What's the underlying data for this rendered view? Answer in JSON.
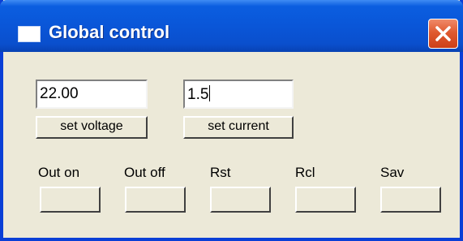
{
  "window": {
    "title": "Global control",
    "close_icon": "close-icon"
  },
  "voltage": {
    "value": "22.00",
    "button_label": "set voltage"
  },
  "current": {
    "value": "1.5",
    "button_label": "set current"
  },
  "controls": {
    "out_on_label": "Out on",
    "out_off_label": "Out off",
    "rst_label": "Rst",
    "rcl_label": "Rcl",
    "sav_label": "Sav"
  },
  "colors": {
    "titlebar": "#0a56d8",
    "face": "#ece9d8",
    "close": "#e05a30"
  }
}
